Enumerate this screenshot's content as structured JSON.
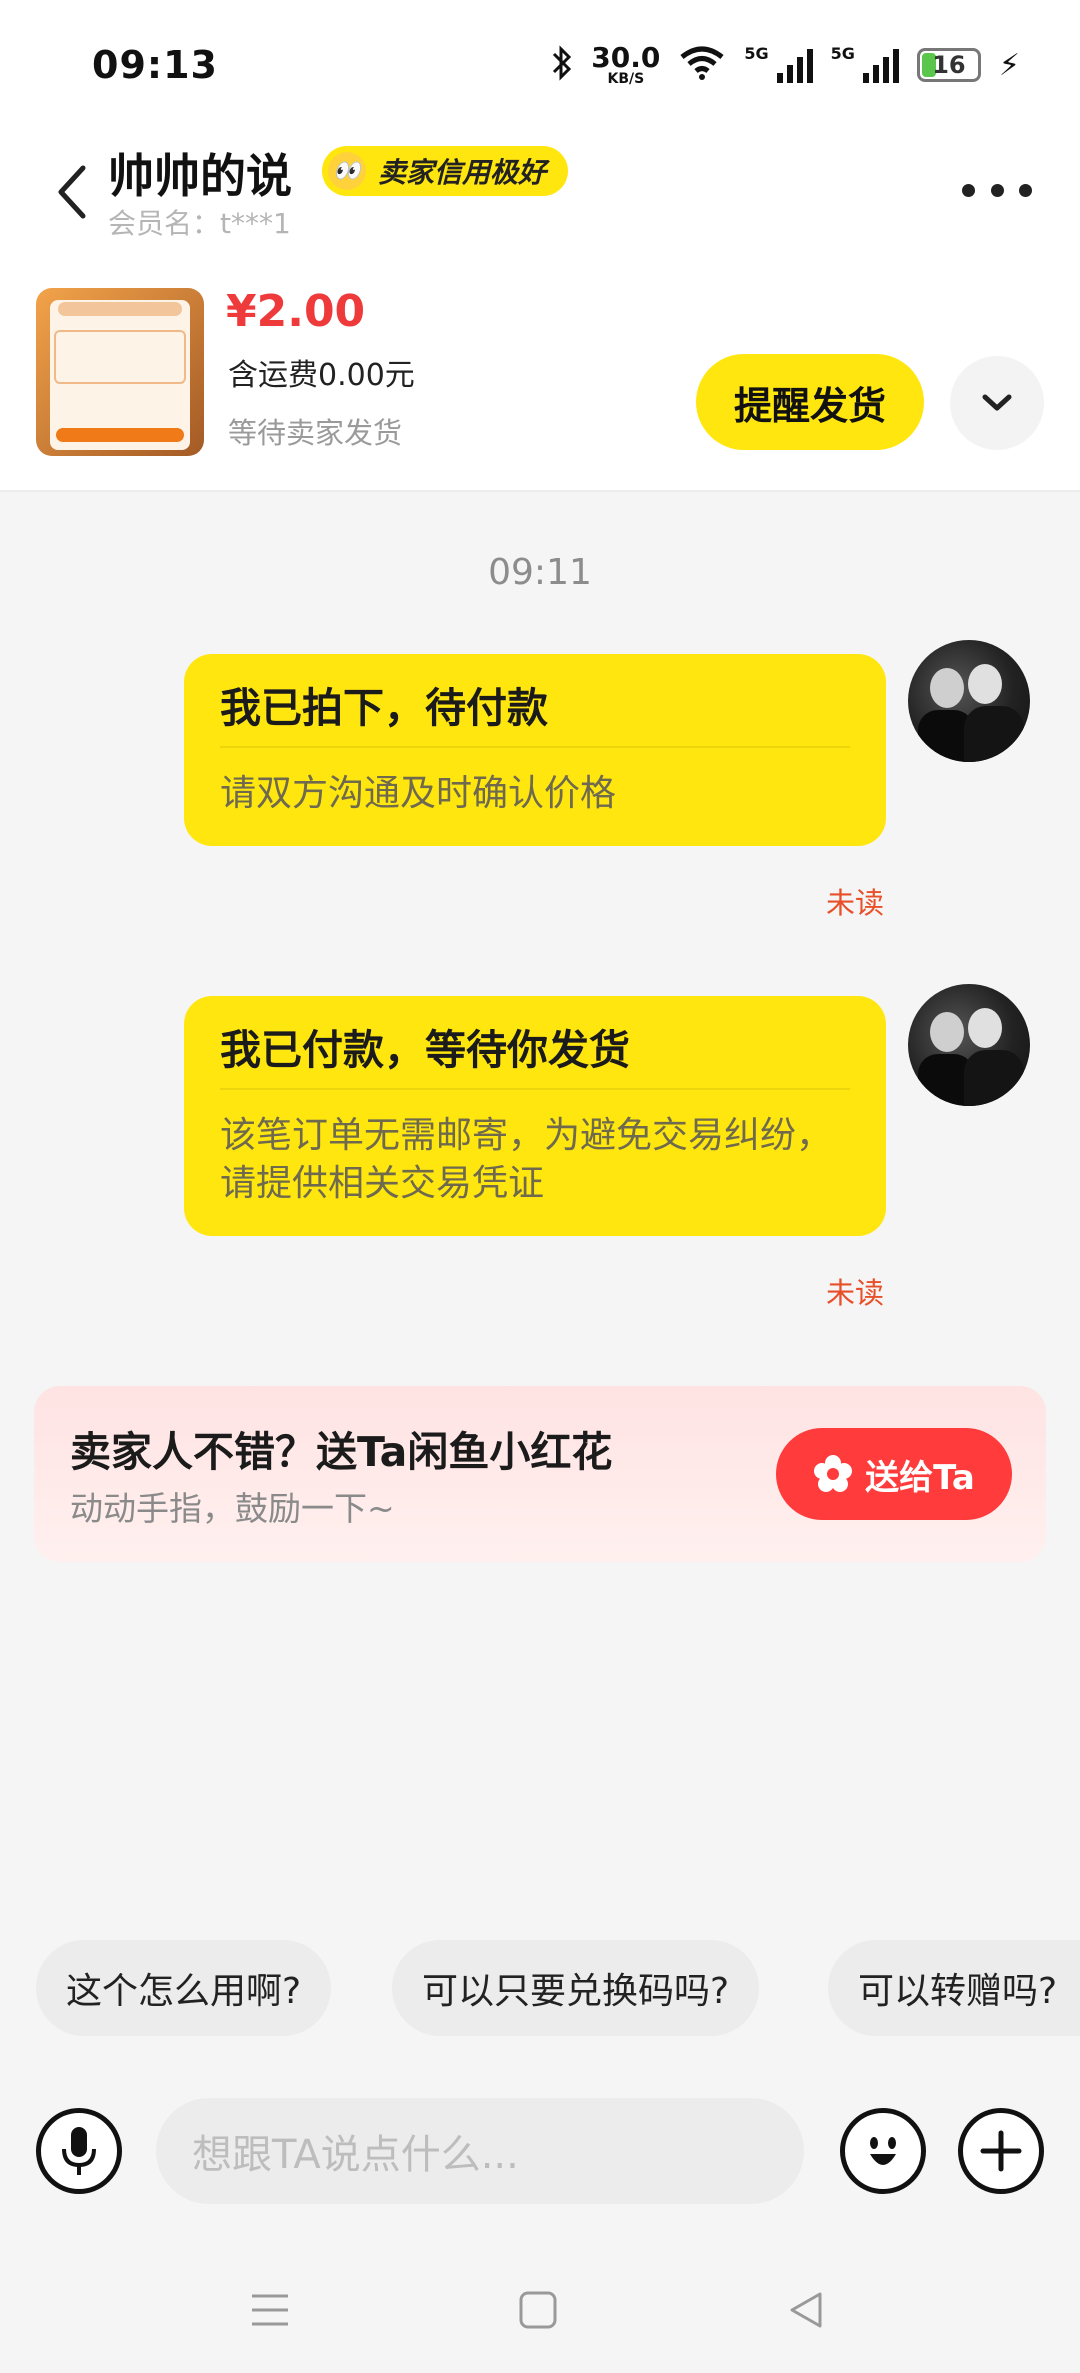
{
  "status_bar": {
    "time": "09:13",
    "net_speed": "30.0",
    "net_speed_unit": "KB/S",
    "network_1": "5G",
    "network_2": "5G",
    "battery": "16",
    "icons": [
      "bluetooth-icon",
      "wifi-icon",
      "signal-icon",
      "battery-icon",
      "charging-icon"
    ]
  },
  "header": {
    "title": "帅帅的说",
    "badge": "卖家信用极好",
    "badge_emoji": "👀",
    "member": "会员名：t***1"
  },
  "product": {
    "price": "¥2.00",
    "shipping": "含运费0.00元",
    "status": "等待卖家发货",
    "remind_button": "提醒发货"
  },
  "chat": {
    "time": "09:11",
    "messages": [
      {
        "title": "我已拍下，待付款",
        "body": "请双方沟通及时确认价格",
        "read_status": "未读"
      },
      {
        "title": "我已付款，等待你发货",
        "body": "该笔订单无需邮寄，为避免交易纠纷，请提供相关交易凭证",
        "read_status": "未读"
      }
    ]
  },
  "flower_card": {
    "title": "卖家人不错？送Ta闲鱼小红花",
    "subtitle": "动动手指，鼓励一下~",
    "button": "送给Ta"
  },
  "quick_replies": [
    "这个怎么用啊?",
    "可以只要兑换码吗?",
    "可以转赠吗?"
  ],
  "input": {
    "placeholder": "想跟TA说点什么..."
  },
  "colors": {
    "brand_yellow": "#ffe60f",
    "price_red": "#ee3a3a",
    "unread_orange": "#e8502a",
    "gift_red": "#ff3b3b"
  }
}
